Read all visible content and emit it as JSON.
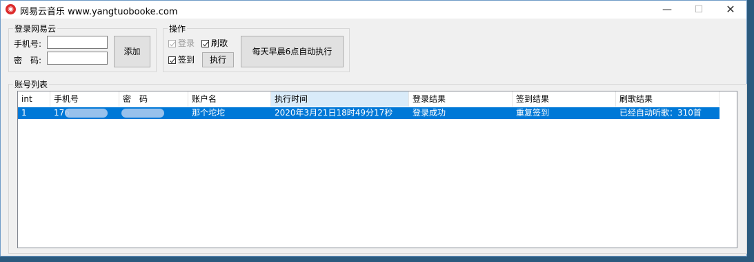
{
  "window": {
    "title": "网易云音乐 www.yangtuobooke.com"
  },
  "login": {
    "group_title": "登录网易云",
    "phone_label": "手机号:",
    "password_label": "密　码:",
    "phone_value": "",
    "password_value": "",
    "add_button": "添加"
  },
  "ops": {
    "group_title": "操作",
    "login_check": "登录",
    "brush_check": "刷歌",
    "signin_check": "签到",
    "execute_button": "执行",
    "daily_button": "每天早晨6点自动执行"
  },
  "accounts": {
    "group_title": "账号列表",
    "columns": [
      "int",
      "手机号",
      "密　码",
      "账户名",
      "执行时间",
      "登录结果",
      "签到结果",
      "刷歌结果"
    ],
    "rows": [
      {
        "int": "1",
        "phone": "176",
        "password": "",
        "account": "那个坨坨",
        "exec_time": "2020年3月21日18时49分17秒",
        "login_result": "登录成功",
        "signin_result": "重复签到",
        "brush_result": "已经自动听歌：310首"
      }
    ]
  }
}
